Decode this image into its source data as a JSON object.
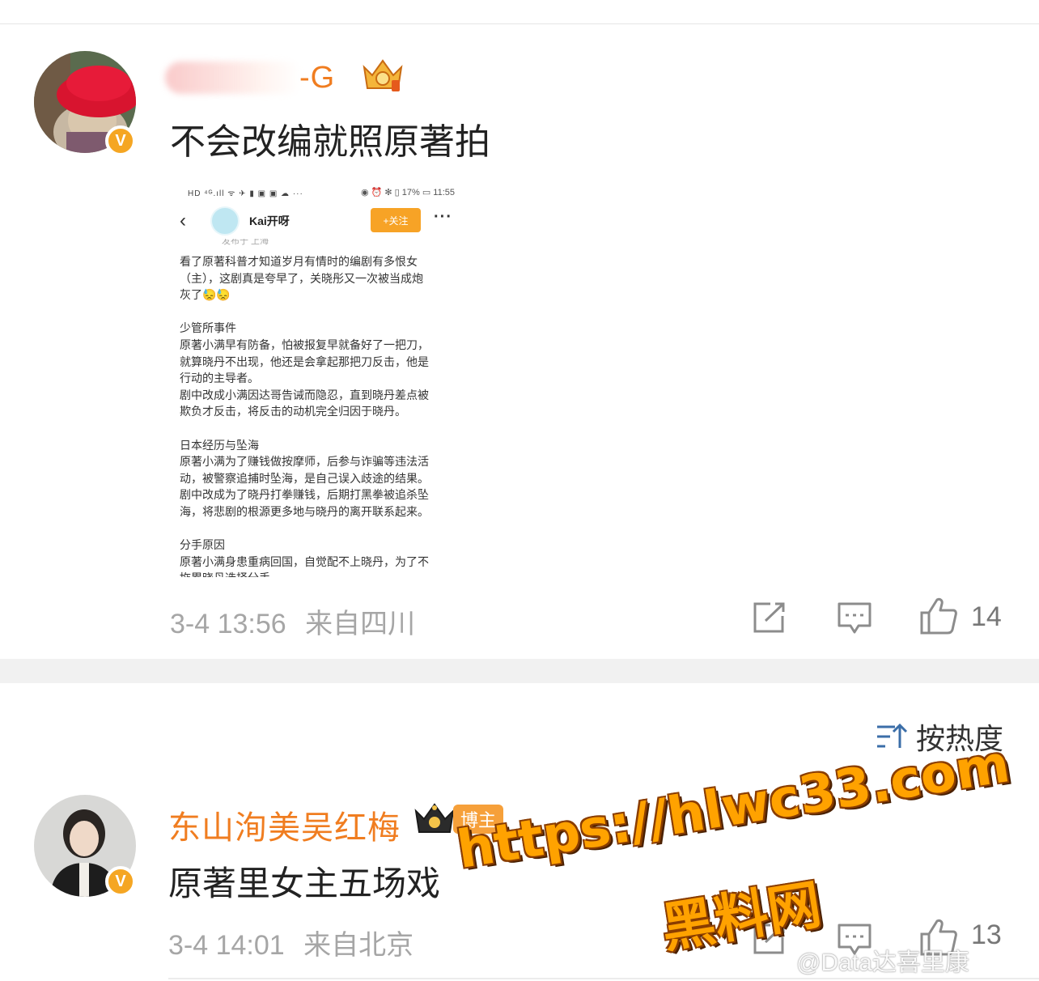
{
  "post1": {
    "username_visible": "-G",
    "text": "不会改编就照原著拍",
    "avatar_badge": "V",
    "embedded_screenshot": {
      "status_left": "HD ⁴ᴳ.ıll ᯤ ✈ ▮ ▣ ▣ ☁ ···",
      "status_right": "◉ ⏰ ✻ ▯ 17% ▭ 11:55",
      "back": "‹",
      "name": "Kai开呀",
      "follow_label": "+关注",
      "more": "···",
      "subline": "发布于 上海",
      "lines": [
        "看了原著科普才知道岁月有情时的编剧有多恨女",
        "（主），这剧真是夸早了，关晓彤又一次被当成炮",
        "灰了😓😓",
        "",
        "少管所事件",
        "原著小满早有防备，怕被报复早就备好了一把刀，",
        "就算晓丹不出现，他还是会拿起那把刀反击，他是",
        "行动的主导者。",
        "剧中改成小满因达哥告诫而隐忍，直到晓丹差点被",
        "欺负才反击，将反击的动机完全归因于晓丹。",
        "",
        "日本经历与坠海",
        "原著小满为了赚钱做按摩师，后参与诈骗等违法活",
        "动，被警察追捕时坠海，是自己误入歧途的结果。",
        "剧中改成为了晓丹打拳赚钱，后期打黑拳被追杀坠",
        "海，将悲剧的根源更多地与晓丹的离开联系起来。",
        "",
        "分手原因",
        "原著小满身患重病回国，自觉配不上晓丹，为了不",
        "拖累晓丹选择分手。"
      ]
    },
    "time": "3-4 13:56",
    "source": "来自四川",
    "like_count": "14"
  },
  "sort": {
    "label": "按热度"
  },
  "post2": {
    "username": "东山洵美吴红梅",
    "badge_label": "博主",
    "avatar_badge": "V",
    "text": "原著里女主五场戏",
    "time": "3-4 14:01",
    "source": "来自北京",
    "like_count": "13"
  },
  "watermark": {
    "url": "https://hlwc33.com",
    "site_name": "黑料网",
    "weibo_handle": "@Data达喜里康"
  },
  "colors": {
    "username_orange": "#f07d20",
    "meta_gray": "#a6a6a6",
    "follow_orange": "#f7a326",
    "watermark_orange": "#ffa200"
  }
}
